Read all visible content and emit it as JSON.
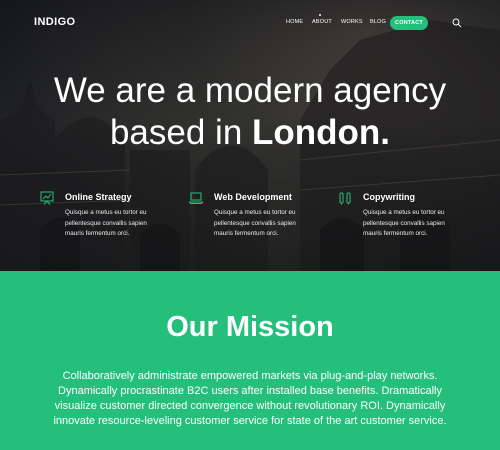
{
  "nav": {
    "logo": "INDIGO",
    "links": [
      "HOME",
      "ABOUT",
      "WORKS",
      "BLOG"
    ],
    "contact": "CONTACT"
  },
  "hero": {
    "headline_line1": "We are a modern agency",
    "headline_line2_prefix": "based in ",
    "headline_line2_bold": "London.",
    "features": [
      {
        "icon": "chart-icon",
        "title": "Online Strategy",
        "text": "Quisque a metus eu tortor eu pellentesque convallis sapien mauris fermentum orci."
      },
      {
        "icon": "laptop-icon",
        "title": "Web Development",
        "text": "Quisque a metus eu tortor eu pellentesque convallis sapien mauris fermentum orci."
      },
      {
        "icon": "pens-icon",
        "title": "Copywriting",
        "text": "Quisque a metus eu tortor eu pellentesque convallis sapien mauris fermentum orci."
      }
    ]
  },
  "mission": {
    "title": "Our Mission",
    "text": "Collaboratively administrate empowered markets via plug-and-play networks. Dynamically procrastinate B2C users after installed base benefits. Dramatically visualize customer directed convergence without revolutionary ROI. Dynamically innovate resource-leveling customer service for state of the art customer service."
  },
  "colors": {
    "accent": "#24c07b",
    "text_light": "#ffffff"
  }
}
